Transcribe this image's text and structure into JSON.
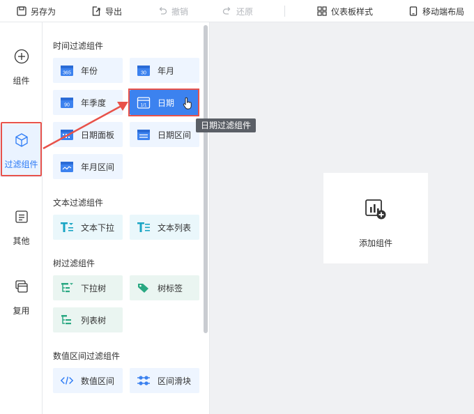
{
  "toolbar": {
    "save_as": "另存为",
    "export": "导出",
    "undo": "撤销",
    "redo": "还原",
    "dashboard_style": "仪表板样式",
    "mobile_layout": "移动端布局"
  },
  "rail": {
    "items": [
      {
        "label": "组件",
        "icon": "plus-circle-icon"
      },
      {
        "label": "过滤组件",
        "icon": "cube-icon",
        "active": true
      },
      {
        "label": "其他",
        "icon": "document-icon"
      },
      {
        "label": "复用",
        "icon": "stack-icon"
      }
    ]
  },
  "panel": {
    "sections": [
      {
        "title": "时间过滤组件",
        "items": [
          {
            "label": "年份",
            "badge": "365"
          },
          {
            "label": "年月",
            "badge": "30"
          },
          {
            "label": "年季度",
            "badge": "90"
          },
          {
            "label": "日期",
            "badge": "1/1",
            "selected": true
          },
          {
            "label": "日期面板"
          },
          {
            "label": "日期区间"
          },
          {
            "label": "年月区间"
          }
        ]
      },
      {
        "title": "文本过滤组件",
        "items": [
          {
            "label": "文本下拉"
          },
          {
            "label": "文本列表"
          }
        ]
      },
      {
        "title": "树过滤组件",
        "items": [
          {
            "label": "下拉树"
          },
          {
            "label": "树标签"
          },
          {
            "label": "列表树"
          }
        ]
      },
      {
        "title": "数值区间过滤组件",
        "items": [
          {
            "label": "数值区间"
          },
          {
            "label": "区间滑块"
          }
        ]
      }
    ]
  },
  "tooltip": "日期过滤组件",
  "canvas": {
    "add_label": "添加组件"
  },
  "colors": {
    "accent": "#2e7cf6",
    "highlight": "#e8524a",
    "canvas_bg": "#f0f1f3"
  }
}
